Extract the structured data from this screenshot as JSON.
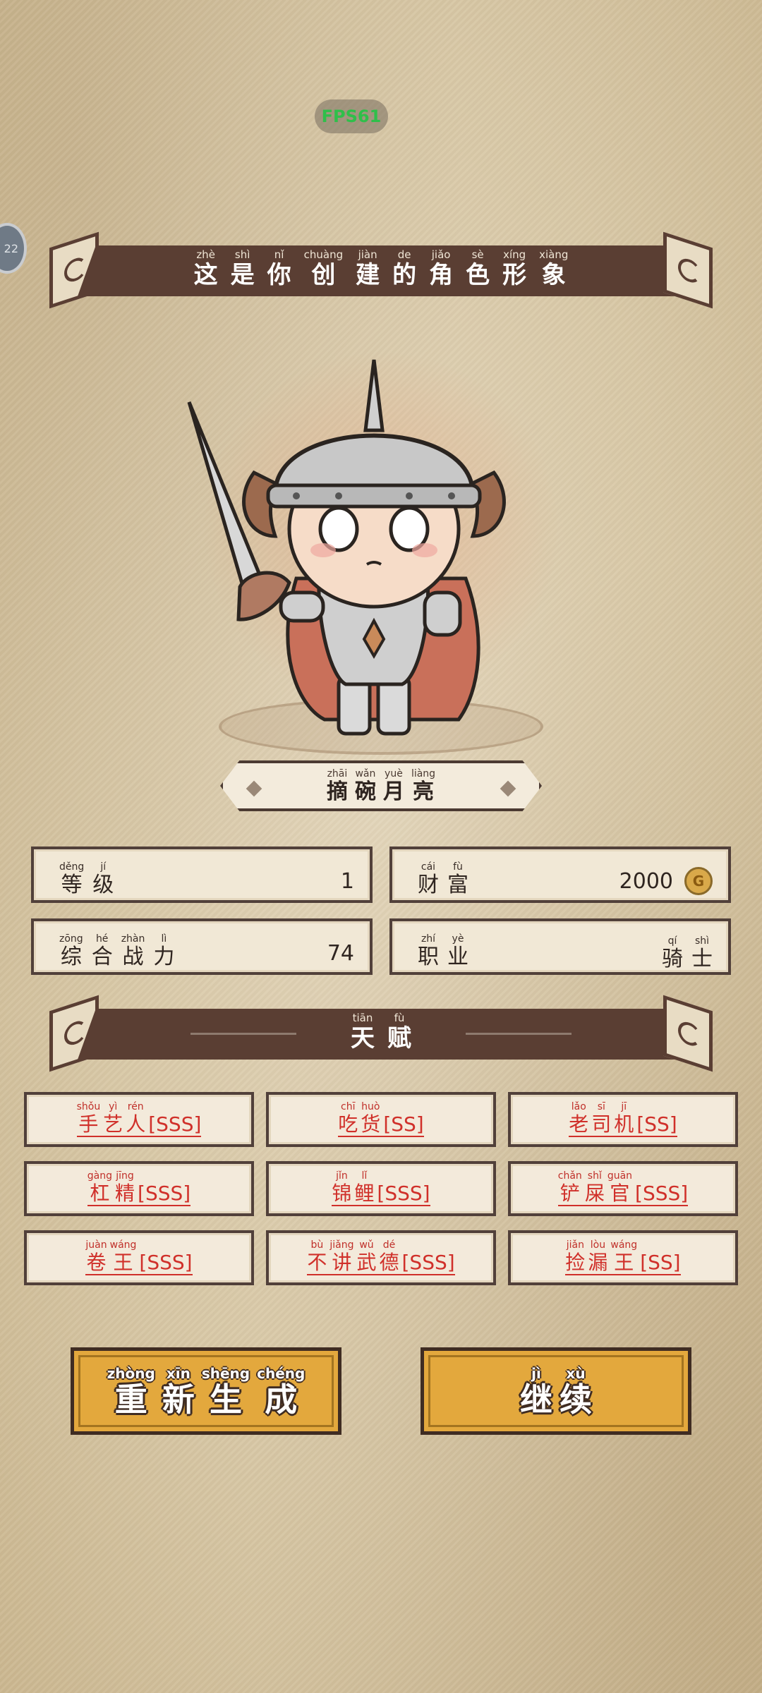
{
  "overlay": {
    "fps": "FPS61",
    "side_badge": "22"
  },
  "title_banner": {
    "chars": [
      {
        "py": "zhè",
        "hz": "这"
      },
      {
        "py": "shì",
        "hz": "是"
      },
      {
        "py": "nǐ",
        "hz": "你"
      },
      {
        "py": "chuàng",
        "hz": "创"
      },
      {
        "py": "jiàn",
        "hz": "建"
      },
      {
        "py": "de",
        "hz": "的"
      },
      {
        "py": "jiǎo",
        "hz": "角"
      },
      {
        "py": "sè",
        "hz": "色"
      },
      {
        "py": "xíng",
        "hz": "形"
      },
      {
        "py": "xiàng",
        "hz": "象"
      }
    ]
  },
  "character": {
    "name_chars": [
      {
        "py": "zhāi",
        "hz": "摘"
      },
      {
        "py": "wǎn",
        "hz": "碗"
      },
      {
        "py": "yuè",
        "hz": "月"
      },
      {
        "py": "liàng",
        "hz": "亮"
      }
    ]
  },
  "stats": {
    "level": {
      "label": [
        {
          "py": "děng",
          "hz": "等"
        },
        {
          "py": "jí",
          "hz": "级"
        }
      ],
      "value": "1"
    },
    "wealth": {
      "label": [
        {
          "py": "cái",
          "hz": "财"
        },
        {
          "py": "fù",
          "hz": "富"
        }
      ],
      "value": "2000",
      "icon": "coin-icon"
    },
    "power": {
      "label": [
        {
          "py": "zōng",
          "hz": "综"
        },
        {
          "py": "hé",
          "hz": "合"
        },
        {
          "py": "zhàn",
          "hz": "战"
        },
        {
          "py": "lì",
          "hz": "力"
        }
      ],
      "value": "74"
    },
    "job": {
      "label": [
        {
          "py": "zhí",
          "hz": "职"
        },
        {
          "py": "yè",
          "hz": "业"
        }
      ],
      "value": [
        {
          "py": "qí",
          "hz": "骑"
        },
        {
          "py": "shì",
          "hz": "士"
        }
      ]
    }
  },
  "talent_banner": {
    "chars": [
      {
        "py": "tiān",
        "hz": "天"
      },
      {
        "py": "fù",
        "hz": "赋"
      }
    ]
  },
  "talents": [
    {
      "chars": [
        {
          "py": "shǒu",
          "hz": "手"
        },
        {
          "py": "yì",
          "hz": "艺"
        },
        {
          "py": "rén",
          "hz": "人"
        }
      ],
      "grade": "[SSS]"
    },
    {
      "chars": [
        {
          "py": "chī",
          "hz": "吃"
        },
        {
          "py": "huò",
          "hz": "货"
        }
      ],
      "grade": "[SS]"
    },
    {
      "chars": [
        {
          "py": "lǎo",
          "hz": "老"
        },
        {
          "py": "sī",
          "hz": "司"
        },
        {
          "py": "jī",
          "hz": "机"
        }
      ],
      "grade": "[SS]"
    },
    {
      "chars": [
        {
          "py": "gàng",
          "hz": "杠"
        },
        {
          "py": "jīng",
          "hz": "精"
        }
      ],
      "grade": "[SSS]"
    },
    {
      "chars": [
        {
          "py": "jǐn",
          "hz": "锦"
        },
        {
          "py": "lǐ",
          "hz": "鲤"
        }
      ],
      "grade": "[SSS]"
    },
    {
      "chars": [
        {
          "py": "chǎn",
          "hz": "铲"
        },
        {
          "py": "shǐ",
          "hz": "屎"
        },
        {
          "py": "guān",
          "hz": "官"
        }
      ],
      "grade": "[SSS]"
    },
    {
      "chars": [
        {
          "py": "juàn",
          "hz": "卷"
        },
        {
          "py": "wáng",
          "hz": "王"
        }
      ],
      "grade": "[SSS]"
    },
    {
      "chars": [
        {
          "py": "bù",
          "hz": "不"
        },
        {
          "py": "jiǎng",
          "hz": "讲"
        },
        {
          "py": "wǔ",
          "hz": "武"
        },
        {
          "py": "dé",
          "hz": "德"
        }
      ],
      "grade": "[SSS]"
    },
    {
      "chars": [
        {
          "py": "jiǎn",
          "hz": "捡"
        },
        {
          "py": "lòu",
          "hz": "漏"
        },
        {
          "py": "wáng",
          "hz": "王"
        }
      ],
      "grade": "[SS]"
    }
  ],
  "buttons": {
    "regenerate": [
      {
        "py": "zhòng",
        "hz": "重"
      },
      {
        "py": "xīn",
        "hz": "新"
      },
      {
        "py": "shēng",
        "hz": "生"
      },
      {
        "py": "chéng",
        "hz": "成"
      }
    ],
    "continue": [
      {
        "py": "jì",
        "hz": "继"
      },
      {
        "py": "xù",
        "hz": "续"
      }
    ]
  }
}
